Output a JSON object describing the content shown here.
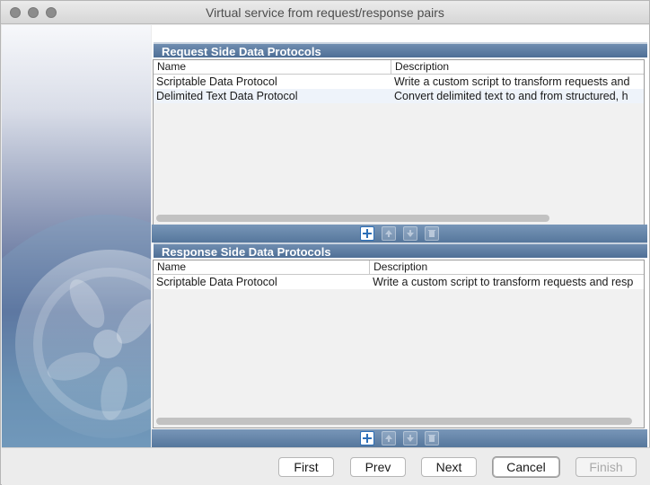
{
  "window": {
    "title": "Virtual service from request/response pairs"
  },
  "request_panel": {
    "header": "Request Side Data Protocols",
    "columns": [
      "Name",
      "Description"
    ],
    "rows": [
      {
        "name": "Scriptable Data Protocol",
        "description": "Write a custom script to transform requests and"
      },
      {
        "name": "Delimited Text Data Protocol",
        "description": "Convert delimited text to and from structured, h"
      }
    ]
  },
  "response_panel": {
    "header": "Response Side Data Protocols",
    "columns": [
      "Name",
      "Description"
    ],
    "rows": [
      {
        "name": "Scriptable Data Protocol",
        "description": "Write a custom script to transform requests and resp"
      }
    ]
  },
  "toolbar_icons": [
    "add-icon",
    "move-up-icon",
    "move-down-icon",
    "delete-icon"
  ],
  "buttons": {
    "first": "First",
    "prev": "Prev",
    "next": "Next",
    "cancel": "Cancel",
    "finish": "Finish"
  },
  "colors": {
    "header_blue": "#56779c",
    "add_icon_blue": "#2c6fb8"
  }
}
